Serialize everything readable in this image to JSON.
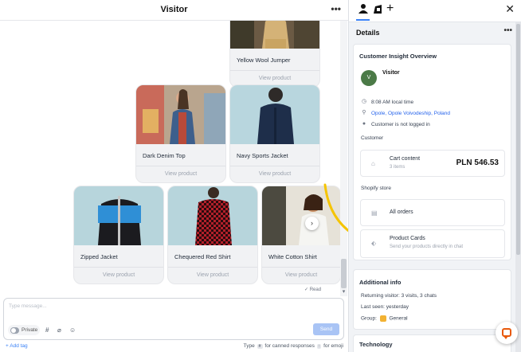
{
  "chat": {
    "title": "Visitor",
    "more": "•••",
    "read_status": "✓ Read",
    "composer_placeholder": "Type message...",
    "private_label": "Private",
    "send_label": "Send",
    "add_tag": "+ Add tag",
    "hint_type": "Type",
    "hint_key1": "#",
    "hint_canned": "for canned responses",
    "hint_key2": ":",
    "hint_emoji": "for emoji"
  },
  "products": [
    {
      "name": "Yellow Wool Jumper",
      "action": "View product"
    },
    {
      "name": "Dark Denim Top",
      "action": "View product"
    },
    {
      "name": "Navy Sports Jacket",
      "action": "View product"
    },
    {
      "name": "Zipped Jacket",
      "action": "View product"
    },
    {
      "name": "Chequered Red Shirt",
      "action": "View product"
    },
    {
      "name": "White Cotton Shirt",
      "action": "View product"
    }
  ],
  "panel": {
    "details_title": "Details",
    "details_more": "•••",
    "overview_title": "Customer Insight Overview",
    "avatar_letter": "V",
    "visitor_name": "Visitor",
    "local_time": "8:08 AM local time",
    "location": "Opole, Opole Voivodeship, Poland",
    "login_status": "Customer is not logged in",
    "customer_label": "Customer",
    "cart_title": "Cart content",
    "cart_items": "3 items",
    "cart_amount": "PLN 546.53",
    "shopify_label": "Shopify store",
    "all_orders": "All orders",
    "product_cards_title": "Product Cards",
    "product_cards_sub": "Send your products directly in chat",
    "additional_title": "Additional info",
    "returning": "Returning visitor: 3 visits, 3 chats",
    "last_seen": "Last seen: yesterday",
    "group_prefix": "Group:",
    "group_name": "General",
    "technology_title": "Technology"
  },
  "colors": {
    "accent": "#3b82f6",
    "send_button": "#a9c4f5",
    "avatar": "#4b7a47",
    "arrow": "#f5c400",
    "chat_widget": "#e8590c"
  }
}
